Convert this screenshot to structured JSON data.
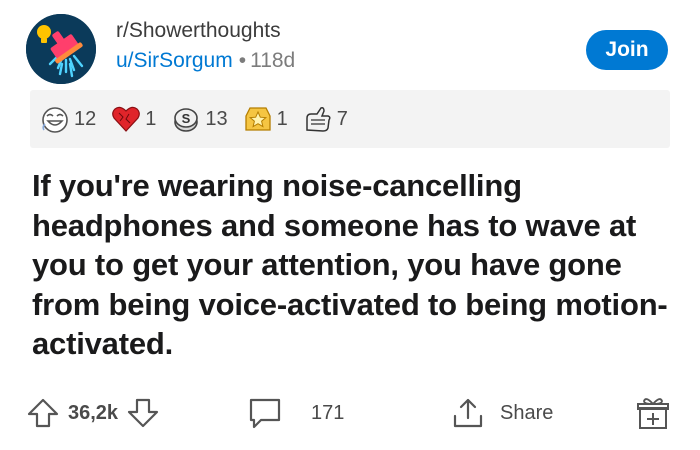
{
  "post": {
    "subreddit": "r/Showerthoughts",
    "author": "u/SirSorgum",
    "separator": "•",
    "age": "118d",
    "join_label": "Join",
    "title": "If you're wearing noise-cancelling headphones and someone has to wave at you to get your attention, you have gone from being voice-activated to being motion-activated."
  },
  "awards": [
    {
      "icon": "laughing-face-award-icon",
      "count": "12"
    },
    {
      "icon": "heart-award-icon",
      "count": "1"
    },
    {
      "icon": "silver-coin-award-icon",
      "count": "13"
    },
    {
      "icon": "gold-star-award-icon",
      "count": "1"
    },
    {
      "icon": "wholesome-hands-award-icon",
      "count": "7"
    }
  ],
  "actions": {
    "upvotes": "36,2k",
    "comments": "171",
    "share_label": "Share"
  },
  "colors": {
    "accent": "#0079d3",
    "text": "#1a1a1b",
    "muted": "#7c7c7c",
    "awards_bg": "#f3f3f3"
  }
}
